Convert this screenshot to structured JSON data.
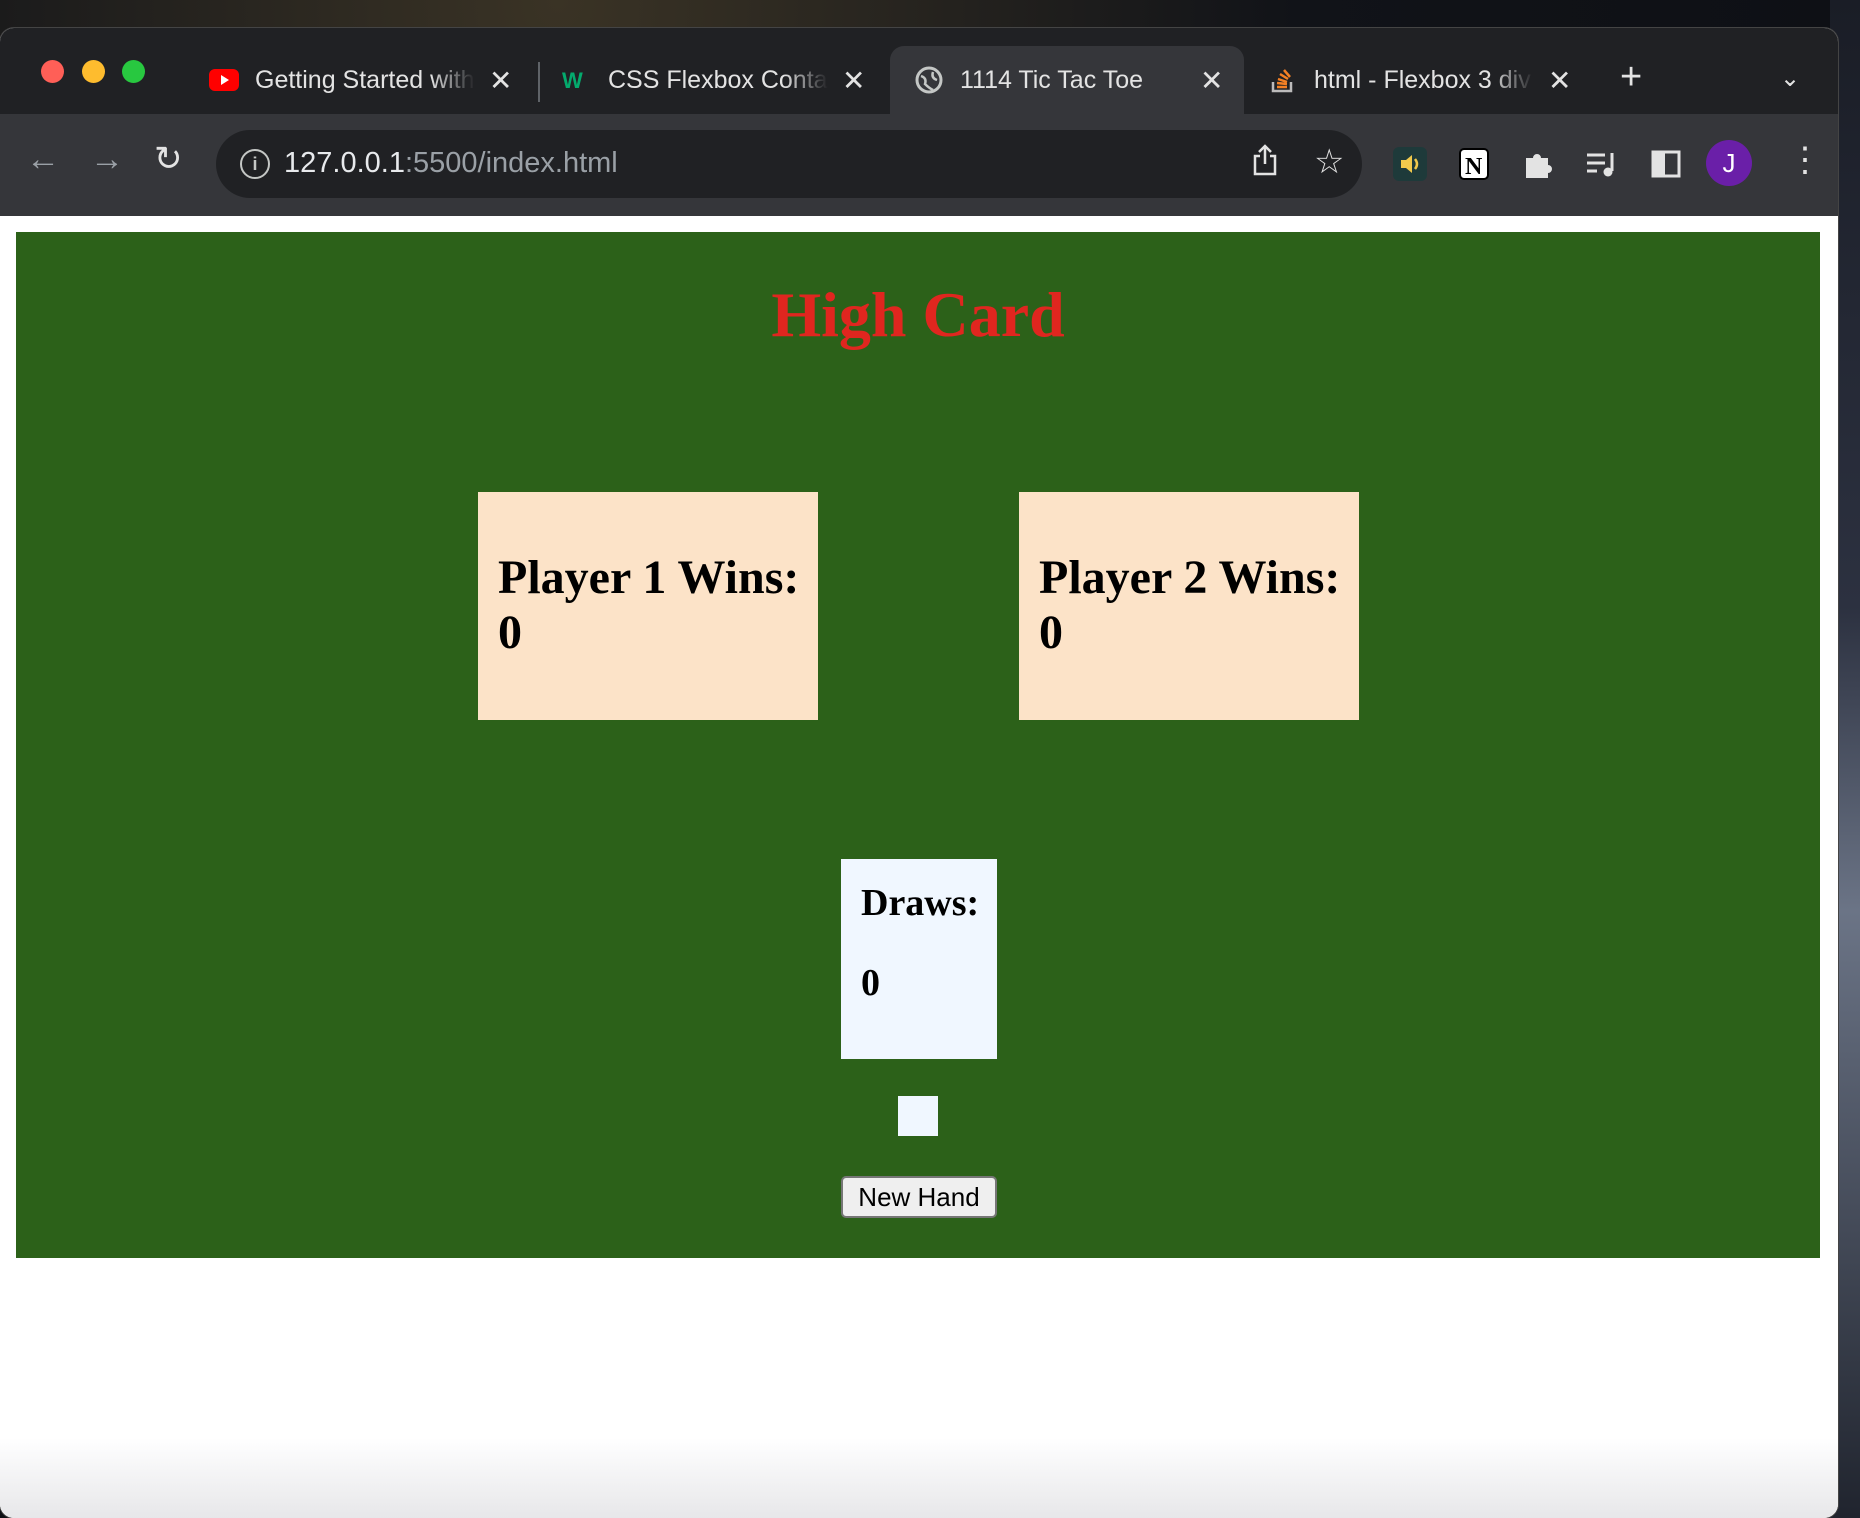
{
  "browser": {
    "tabs": [
      {
        "title": "Getting Started with",
        "icon": "youtube-icon",
        "active": false
      },
      {
        "title": "CSS Flexbox Contai",
        "icon": "w3schools-icon",
        "active": false
      },
      {
        "title": "1114 Tic Tac Toe",
        "icon": "globe-icon",
        "active": true
      },
      {
        "title": "html - Flexbox 3 div",
        "icon": "stackoverflow-icon",
        "active": false
      }
    ],
    "url_host": "127.0.0.1",
    "url_rest": ":5500/index.html",
    "profile_initial": "J"
  },
  "game": {
    "title": "High Card",
    "player1": {
      "label": "Player 1 Wins:",
      "wins": "0"
    },
    "player2": {
      "label": "Player 2 Wins:",
      "wins": "0"
    },
    "draws": {
      "label": "Draws:",
      "count": "0"
    },
    "new_hand_label": "New Hand"
  },
  "colors": {
    "felt": "#2c6119",
    "title": "#e0261f",
    "score_box": "#fce3c8",
    "draws_box": "#f0f7ff"
  }
}
